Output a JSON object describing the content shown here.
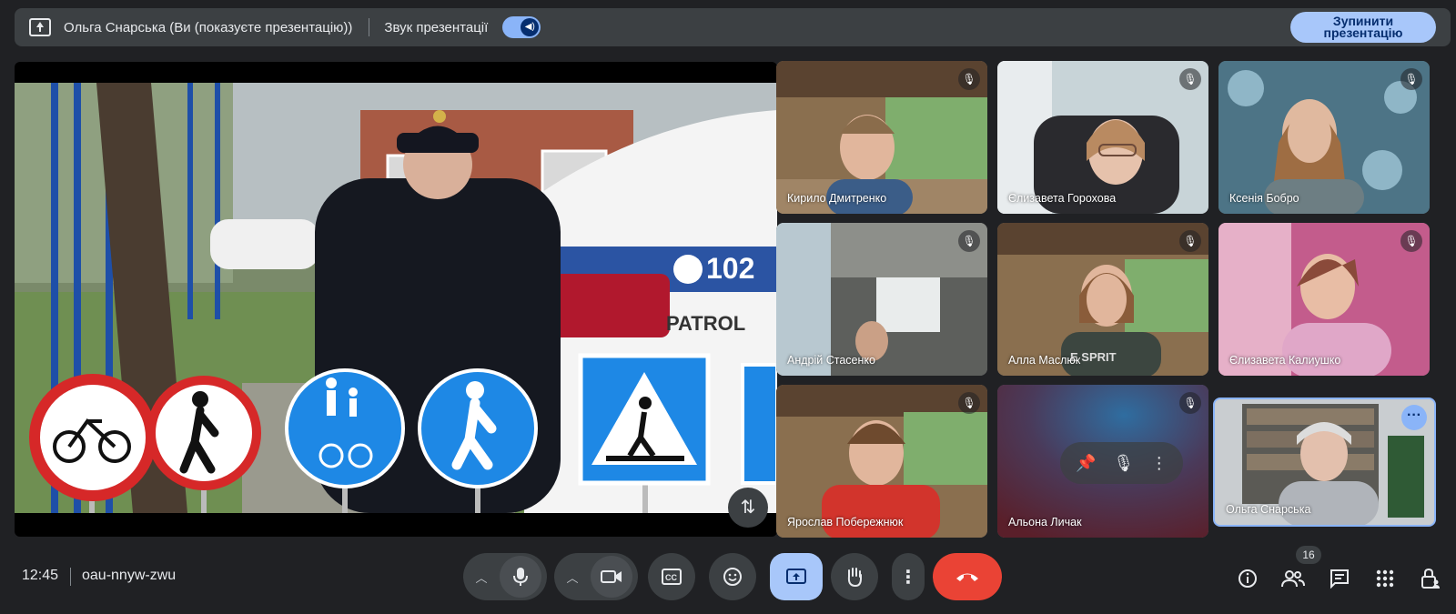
{
  "topbar": {
    "title": "Ольга Снарська (Ви (показуєте презентацію))",
    "sound_label": "Звук презентації",
    "stop_line1": "Зупинити",
    "stop_line2": "презентацію"
  },
  "presentation": {
    "car_number": "102",
    "car_text": "PATROL"
  },
  "participants": [
    {
      "name": "Кирило Дмитренко"
    },
    {
      "name": "Єлизавета Горохова"
    },
    {
      "name": "Ксенія Бобро"
    },
    {
      "name": "Андрій Стасенко"
    },
    {
      "name": "Алла Маслюк",
      "shirt": "E SPRIT"
    },
    {
      "name": "Єлизавета Калиушко"
    },
    {
      "name": "Ярослав Побережнюк"
    },
    {
      "name": "Альона Личак"
    }
  ],
  "self": {
    "name": "Ольга Снарська"
  },
  "bottom": {
    "time": "12:45",
    "meeting_code": "oau-nnyw-zwu",
    "participant_count": "16"
  },
  "icons": {
    "mic": "microphone-icon",
    "camera": "camera-icon",
    "captions": "captions-icon",
    "emoji": "emoji-icon",
    "present": "present-screen-icon",
    "hand": "raise-hand-icon",
    "more": "more-vert-icon",
    "end": "end-call-icon"
  },
  "colors": {
    "accent": "#a8c7fa",
    "end_call": "#ea4335",
    "bar": "#3c4043"
  }
}
